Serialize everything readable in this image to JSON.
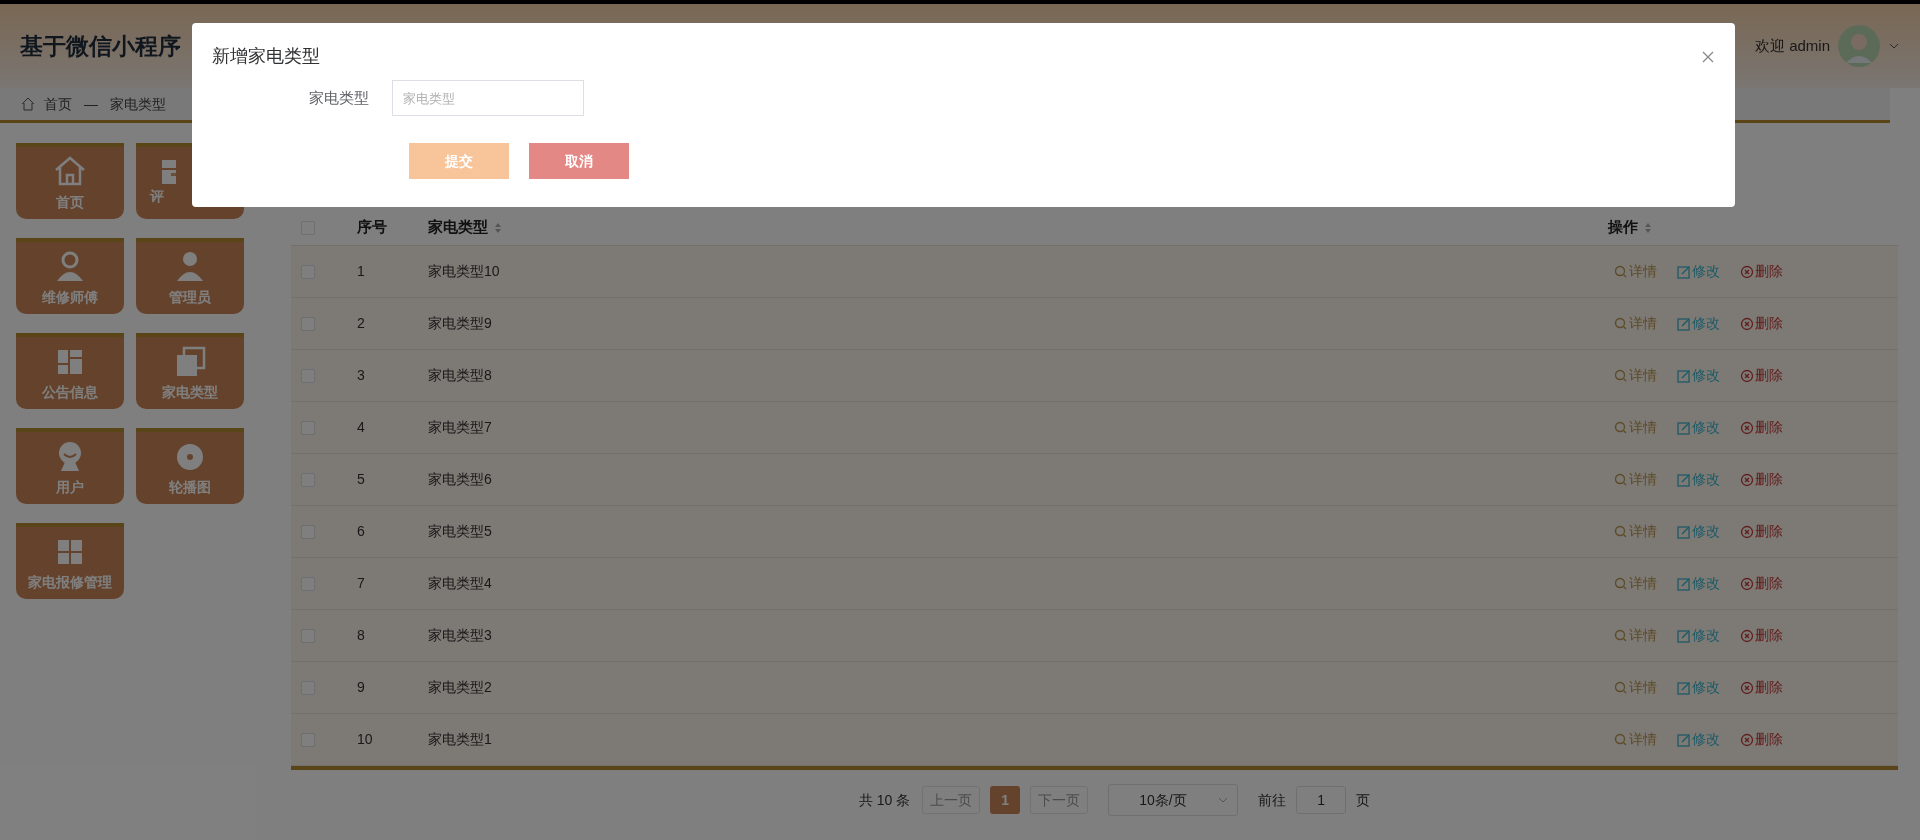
{
  "header": {
    "title": "基于微信小程序",
    "welcome": "欢迎 admin"
  },
  "breadcrumb": {
    "items": [
      "首页",
      "家电类型"
    ],
    "separator": "—"
  },
  "sidebar": {
    "items": [
      {
        "label": "首页"
      },
      {
        "label": "评",
        "clipped": true
      },
      {
        "label": "维修师傅"
      },
      {
        "label": "管理员"
      },
      {
        "label": "公告信息"
      },
      {
        "label": "家电类型"
      },
      {
        "label": "用户"
      },
      {
        "label": "轮播图"
      },
      {
        "label": "家电报修管理"
      }
    ]
  },
  "table": {
    "header_checked": false,
    "columns": [
      "序号",
      "家电类型",
      "操作"
    ],
    "rows": [
      {
        "checked": false,
        "no": "1",
        "name": "家电类型10",
        "actions": [
          {
            "kind": "detail",
            "label": "详情"
          },
          {
            "kind": "edit",
            "label": "修改"
          },
          {
            "kind": "delete",
            "label": "删除"
          }
        ]
      },
      {
        "checked": false,
        "no": "2",
        "name": "家电类型9",
        "actions": [
          {
            "kind": "detail",
            "label": "详情"
          },
          {
            "kind": "edit",
            "label": "修改"
          },
          {
            "kind": "delete",
            "label": "删除"
          }
        ]
      },
      {
        "checked": false,
        "no": "3",
        "name": "家电类型8",
        "actions": [
          {
            "kind": "detail",
            "label": "详情"
          },
          {
            "kind": "edit",
            "label": "修改"
          },
          {
            "kind": "delete",
            "label": "删除"
          }
        ]
      },
      {
        "checked": false,
        "no": "4",
        "name": "家电类型7",
        "actions": [
          {
            "kind": "detail",
            "label": "详情"
          },
          {
            "kind": "edit",
            "label": "修改"
          },
          {
            "kind": "delete",
            "label": "删除"
          }
        ]
      },
      {
        "checked": false,
        "no": "5",
        "name": "家电类型6",
        "actions": [
          {
            "kind": "detail",
            "label": "详情"
          },
          {
            "kind": "edit",
            "label": "修改"
          },
          {
            "kind": "delete",
            "label": "删除"
          }
        ]
      },
      {
        "checked": false,
        "no": "6",
        "name": "家电类型5",
        "actions": [
          {
            "kind": "detail",
            "label": "详情"
          },
          {
            "kind": "edit",
            "label": "修改"
          },
          {
            "kind": "delete",
            "label": "删除"
          }
        ]
      },
      {
        "checked": false,
        "no": "7",
        "name": "家电类型4",
        "actions": [
          {
            "kind": "detail",
            "label": "详情"
          },
          {
            "kind": "edit",
            "label": "修改"
          },
          {
            "kind": "delete",
            "label": "删除"
          }
        ]
      },
      {
        "checked": false,
        "no": "8",
        "name": "家电类型3",
        "actions": [
          {
            "kind": "detail",
            "label": "详情"
          },
          {
            "kind": "edit",
            "label": "修改"
          },
          {
            "kind": "delete",
            "label": "删除"
          }
        ]
      },
      {
        "checked": false,
        "no": "9",
        "name": "家电类型2",
        "actions": [
          {
            "kind": "detail",
            "label": "详情"
          },
          {
            "kind": "edit",
            "label": "修改"
          },
          {
            "kind": "delete",
            "label": "删除"
          }
        ]
      },
      {
        "checked": false,
        "no": "10",
        "name": "家电类型1",
        "actions": [
          {
            "kind": "detail",
            "label": "详情"
          },
          {
            "kind": "edit",
            "label": "修改"
          },
          {
            "kind": "delete",
            "label": "删除"
          }
        ]
      }
    ]
  },
  "pagination": {
    "total": "共 10 条",
    "prev": {
      "label": "上一页",
      "disabled": true
    },
    "pages": [
      {
        "label": "1",
        "selected": true
      }
    ],
    "next": {
      "label": "下一页",
      "disabled": true
    },
    "page_size": "10条/页",
    "goto_label": "前往",
    "goto_value": "1",
    "page_unit": "页"
  },
  "dialog": {
    "title": "新增家电类型",
    "field_label": "家电类型",
    "placeholder": "家电类型",
    "buttons": [
      {
        "kind": "submit",
        "label": "提交"
      },
      {
        "kind": "cancel",
        "label": "取消"
      }
    ]
  }
}
